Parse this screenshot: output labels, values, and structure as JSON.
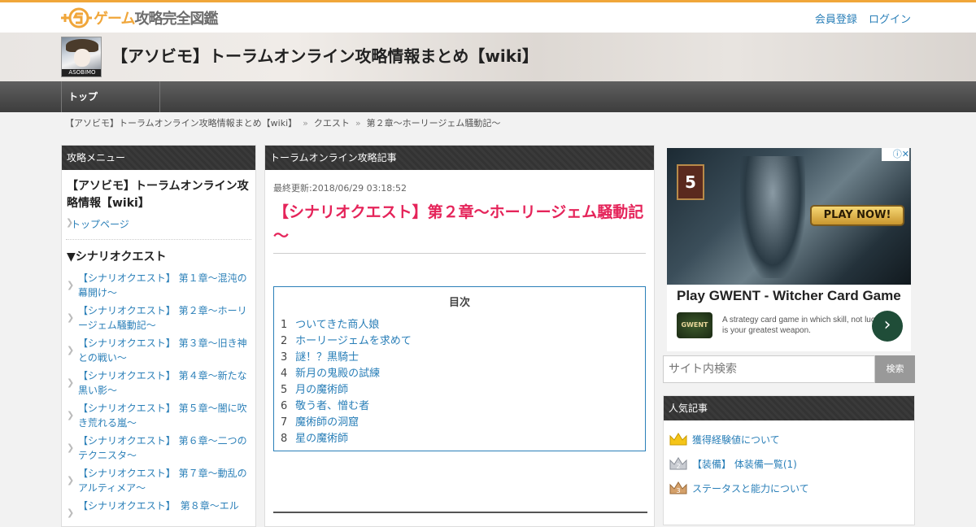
{
  "header": {
    "logo_word": "ゲーム",
    "logo_word2": "攻略完全図鑑",
    "links": [
      "会員登録",
      "ログイン"
    ]
  },
  "banner": {
    "thumb_label": "ASOBIMO",
    "site_title": "【アソビモ】トーラムオンライン攻略情報まとめ【wiki】"
  },
  "nav": {
    "items": [
      "トップ"
    ]
  },
  "breadcrumb": [
    "【アソビモ】トーラムオンライン攻略情報まとめ【wiki】",
    "クエスト",
    "第２章～ホーリージェム騒動記～"
  ],
  "breadcrumb_sep": "»",
  "left": {
    "heading": "攻略メニュー",
    "title": "【アソビモ】トーラムオンライン攻略情報【wiki】",
    "top_link": "トップページ",
    "section": "▼シナリオクエスト",
    "items": [
      "【シナリオクエスト】 第１章～混沌の幕開け～",
      "【シナリオクエスト】 第２章～ホーリージェム騒動記～",
      "【シナリオクエスト】 第３章～旧き神との戦い～",
      "【シナリオクエスト】 第４章～新たな黒い影～",
      "【シナリオクエスト】 第５章～闇に吹き荒れる嵐～",
      "【シナリオクエスト】 第６章～二つのテクニスタ～",
      "【シナリオクエスト】 第７章～動乱のアルティメア～",
      "【シナリオクエスト】　第８章～エル"
    ]
  },
  "article": {
    "heading": "トーラムオンライン攻略記事",
    "updated": "最終更新:2018/06/29 03:18:52",
    "title": "【シナリオクエスト】第２章～ホーリージェム騒動記～",
    "toc_heading": "目次",
    "toc": [
      {
        "n": "1",
        "label": "ついてきた商人娘"
      },
      {
        "n": "2",
        "label": "ホーリージェムを求めて"
      },
      {
        "n": "3",
        "label": "謎！？黒騎士"
      },
      {
        "n": "4",
        "label": "新月の鬼殿の試練"
      },
      {
        "n": "5",
        "label": "月の魔術師"
      },
      {
        "n": "6",
        "label": "敬う者、憎む者"
      },
      {
        "n": "7",
        "label": "魔術師の洞窟"
      },
      {
        "n": "8",
        "label": "星の魔術師"
      }
    ]
  },
  "ad": {
    "card_number": "5",
    "cta": "PLAY NOW!",
    "title": "Play GWENT - Witcher Card Game",
    "logo_text": "GWENT",
    "description": "A strategy card game in which skill, not luck, is your greatest weapon.",
    "arrow": "›"
  },
  "search": {
    "placeholder": "サイト内検索",
    "button": "検索"
  },
  "popular": {
    "heading": "人気記事",
    "items": [
      {
        "label": "獲得経験値について",
        "color": "#f5c518"
      },
      {
        "label": "【装備】 体装備一覧(1)",
        "color": "#b8bcc4"
      },
      {
        "label": "ステータスと能力について",
        "color": "#c9905a"
      }
    ]
  }
}
